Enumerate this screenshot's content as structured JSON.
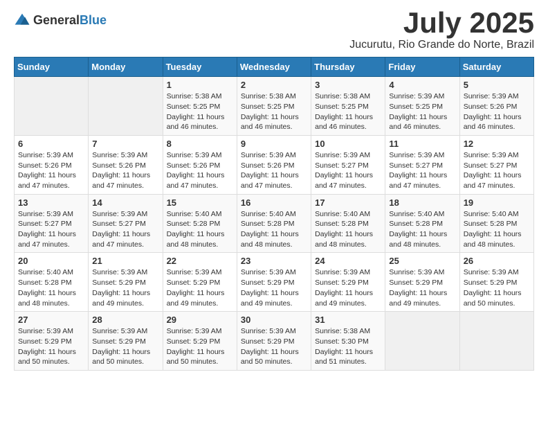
{
  "logo": {
    "general": "General",
    "blue": "Blue"
  },
  "title": "July 2025",
  "location": "Jucurutu, Rio Grande do Norte, Brazil",
  "weekdays": [
    "Sunday",
    "Monday",
    "Tuesday",
    "Wednesday",
    "Thursday",
    "Friday",
    "Saturday"
  ],
  "weeks": [
    [
      {
        "day": "",
        "info": ""
      },
      {
        "day": "",
        "info": ""
      },
      {
        "day": "1",
        "info": "Sunrise: 5:38 AM\nSunset: 5:25 PM\nDaylight: 11 hours and 46 minutes."
      },
      {
        "day": "2",
        "info": "Sunrise: 5:38 AM\nSunset: 5:25 PM\nDaylight: 11 hours and 46 minutes."
      },
      {
        "day": "3",
        "info": "Sunrise: 5:38 AM\nSunset: 5:25 PM\nDaylight: 11 hours and 46 minutes."
      },
      {
        "day": "4",
        "info": "Sunrise: 5:39 AM\nSunset: 5:25 PM\nDaylight: 11 hours and 46 minutes."
      },
      {
        "day": "5",
        "info": "Sunrise: 5:39 AM\nSunset: 5:26 PM\nDaylight: 11 hours and 46 minutes."
      }
    ],
    [
      {
        "day": "6",
        "info": "Sunrise: 5:39 AM\nSunset: 5:26 PM\nDaylight: 11 hours and 47 minutes."
      },
      {
        "day": "7",
        "info": "Sunrise: 5:39 AM\nSunset: 5:26 PM\nDaylight: 11 hours and 47 minutes."
      },
      {
        "day": "8",
        "info": "Sunrise: 5:39 AM\nSunset: 5:26 PM\nDaylight: 11 hours and 47 minutes."
      },
      {
        "day": "9",
        "info": "Sunrise: 5:39 AM\nSunset: 5:26 PM\nDaylight: 11 hours and 47 minutes."
      },
      {
        "day": "10",
        "info": "Sunrise: 5:39 AM\nSunset: 5:27 PM\nDaylight: 11 hours and 47 minutes."
      },
      {
        "day": "11",
        "info": "Sunrise: 5:39 AM\nSunset: 5:27 PM\nDaylight: 11 hours and 47 minutes."
      },
      {
        "day": "12",
        "info": "Sunrise: 5:39 AM\nSunset: 5:27 PM\nDaylight: 11 hours and 47 minutes."
      }
    ],
    [
      {
        "day": "13",
        "info": "Sunrise: 5:39 AM\nSunset: 5:27 PM\nDaylight: 11 hours and 47 minutes."
      },
      {
        "day": "14",
        "info": "Sunrise: 5:39 AM\nSunset: 5:27 PM\nDaylight: 11 hours and 47 minutes."
      },
      {
        "day": "15",
        "info": "Sunrise: 5:40 AM\nSunset: 5:28 PM\nDaylight: 11 hours and 48 minutes."
      },
      {
        "day": "16",
        "info": "Sunrise: 5:40 AM\nSunset: 5:28 PM\nDaylight: 11 hours and 48 minutes."
      },
      {
        "day": "17",
        "info": "Sunrise: 5:40 AM\nSunset: 5:28 PM\nDaylight: 11 hours and 48 minutes."
      },
      {
        "day": "18",
        "info": "Sunrise: 5:40 AM\nSunset: 5:28 PM\nDaylight: 11 hours and 48 minutes."
      },
      {
        "day": "19",
        "info": "Sunrise: 5:40 AM\nSunset: 5:28 PM\nDaylight: 11 hours and 48 minutes."
      }
    ],
    [
      {
        "day": "20",
        "info": "Sunrise: 5:40 AM\nSunset: 5:28 PM\nDaylight: 11 hours and 48 minutes."
      },
      {
        "day": "21",
        "info": "Sunrise: 5:39 AM\nSunset: 5:29 PM\nDaylight: 11 hours and 49 minutes."
      },
      {
        "day": "22",
        "info": "Sunrise: 5:39 AM\nSunset: 5:29 PM\nDaylight: 11 hours and 49 minutes."
      },
      {
        "day": "23",
        "info": "Sunrise: 5:39 AM\nSunset: 5:29 PM\nDaylight: 11 hours and 49 minutes."
      },
      {
        "day": "24",
        "info": "Sunrise: 5:39 AM\nSunset: 5:29 PM\nDaylight: 11 hours and 49 minutes."
      },
      {
        "day": "25",
        "info": "Sunrise: 5:39 AM\nSunset: 5:29 PM\nDaylight: 11 hours and 49 minutes."
      },
      {
        "day": "26",
        "info": "Sunrise: 5:39 AM\nSunset: 5:29 PM\nDaylight: 11 hours and 50 minutes."
      }
    ],
    [
      {
        "day": "27",
        "info": "Sunrise: 5:39 AM\nSunset: 5:29 PM\nDaylight: 11 hours and 50 minutes."
      },
      {
        "day": "28",
        "info": "Sunrise: 5:39 AM\nSunset: 5:29 PM\nDaylight: 11 hours and 50 minutes."
      },
      {
        "day": "29",
        "info": "Sunrise: 5:39 AM\nSunset: 5:29 PM\nDaylight: 11 hours and 50 minutes."
      },
      {
        "day": "30",
        "info": "Sunrise: 5:39 AM\nSunset: 5:29 PM\nDaylight: 11 hours and 50 minutes."
      },
      {
        "day": "31",
        "info": "Sunrise: 5:38 AM\nSunset: 5:30 PM\nDaylight: 11 hours and 51 minutes."
      },
      {
        "day": "",
        "info": ""
      },
      {
        "day": "",
        "info": ""
      }
    ]
  ]
}
